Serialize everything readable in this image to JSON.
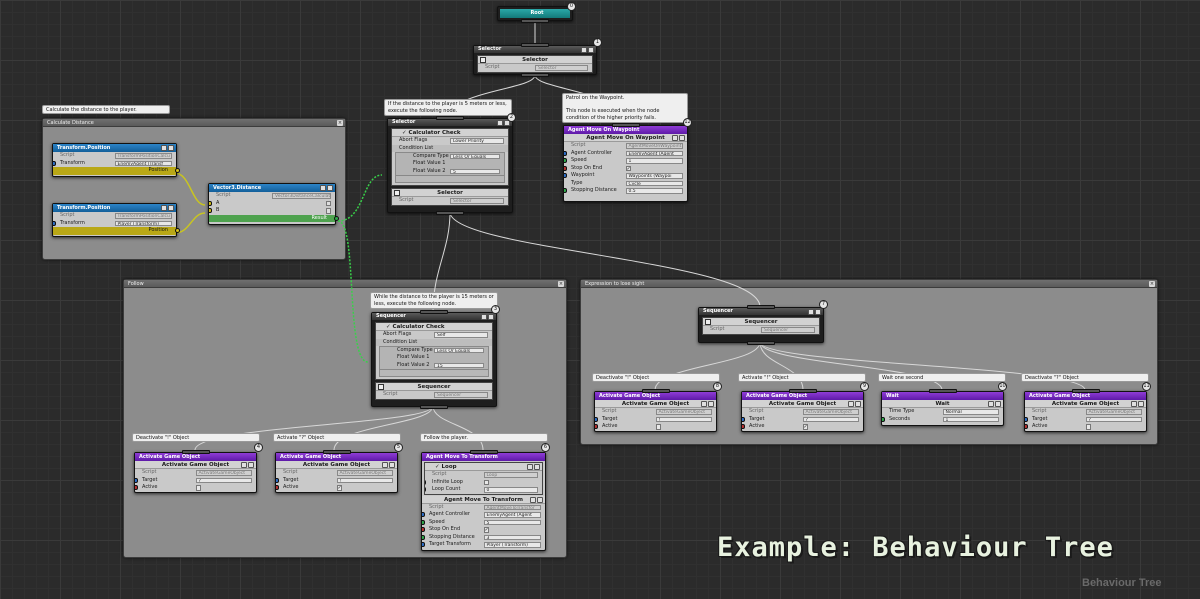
{
  "root": {
    "title": "Root",
    "num": "0"
  },
  "selector1": {
    "header": "Selector",
    "title": "Selector",
    "script_label": "Script",
    "script_value": "Selector",
    "num": "1"
  },
  "comments": {
    "calc": "Calculate the distance to the player.",
    "if5": "If the distance to the player is 5 meters or less, execute the following node.",
    "patrol": "Patrol on the Waypoint.\n\nThis node is executed when the node condition of the higher priority fails.",
    "while15": "While the distance to the player is 15 meters or less, execute the following node.",
    "deact1": "Deactivate \"!\" Object",
    "act_q": "Activate \"?\" Object",
    "follow": "Follow the player.",
    "deact2": "Deactivate \"!\" Object",
    "act_ex": "Activate \"!\" Object",
    "wait": "Wait one second",
    "deact_q": "Deactivate \"?\" Object"
  },
  "groups": {
    "calc": "Calculate Distance",
    "follow": "Follow",
    "lost": "Expression to lose sight"
  },
  "tp1": {
    "header": "Transform.Position",
    "script_label": "Script",
    "script_value": "TransformPositionCalcu",
    "transform_label": "Transform",
    "transform_value": "EnemyAgent (Transf",
    "output": "Position"
  },
  "tp2": {
    "header": "Transform.Position",
    "script_label": "Script",
    "script_value": "TransformPositionCalcu",
    "transform_label": "Transform",
    "transform_value": "Player (Transform)",
    "output": "Position"
  },
  "dist": {
    "header": "Vector3.Distance",
    "script_label": "Script",
    "script_value": "Vector3DistanceCalculat",
    "a": "A",
    "b": "B",
    "output": "Result"
  },
  "sel2": {
    "header": "Selector",
    "num": "2",
    "cond_title": "Calculator Check",
    "abort_label": "Abort Flags",
    "abort_value": "Lower Priority",
    "cond_list": "Condition List",
    "compare_label": "Compare Type",
    "compare_value": "Less Or Equals",
    "fv1_label": "Float Value 1",
    "fv1_value": "",
    "fv2_label": "Float Value 2",
    "fv2_value": "5",
    "title": "Selector",
    "script_label": "Script",
    "script_value": "Selector"
  },
  "waypoint": {
    "header": "Agent Move On Waypoint",
    "num": "12",
    "title": "Agent Move On Waypoint",
    "script_label": "Script",
    "script_value": "AgentMoveOnWaypoint",
    "controller_label": "Agent Controller",
    "controller_value": "EnemyAgent (Agent",
    "speed_label": "Speed",
    "speed_value": "1",
    "stop_label": "Stop On End",
    "wp_label": "Waypoint",
    "wp_value": "Waypoints (Waypoi",
    "type_label": "Type",
    "type_value": "Cycle",
    "sd_label": "Stopping Distance",
    "sd_value": "0.5"
  },
  "seq3": {
    "header": "Sequencer",
    "num": "3",
    "cond_title": "Calculator Check",
    "abort_label": "Abort Flags",
    "abort_value": "Self",
    "cond_list": "Condition List",
    "compare_label": "Compare Type",
    "compare_value": "Less Or Equals",
    "fv1_label": "Float Value 1",
    "fv1_value": "",
    "fv2_label": "Float Value 2",
    "fv2_value": "15",
    "title": "Sequencer",
    "script_label": "Script",
    "script_value": "Sequencer"
  },
  "ago4": {
    "header": "Activate Game Object",
    "num": "4",
    "title": "Activate Game Object",
    "script_label": "Script",
    "script_value": "ActivateGameObject",
    "target_label": "Target",
    "target_value": "?",
    "active_label": "Active",
    "active_checked": ""
  },
  "ago5": {
    "header": "Activate Game Object",
    "num": "5",
    "title": "Activate Game Object",
    "script_label": "Script",
    "script_value": "ActivateGameObject",
    "target_label": "Target",
    "target_value": "!",
    "active_label": "Active",
    "active_checked": "✓"
  },
  "loop6": {
    "header": "Agent Move To Transform",
    "num": "6",
    "dec_title": "Loop",
    "dec_script_label": "Script",
    "dec_script_value": "Loop",
    "inf_label": "Infinite Loop",
    "count_label": "Loop Count",
    "count_value": "0",
    "title": "Agent Move To Transform",
    "script_label": "Script",
    "script_value": "AgentMoveToTransfor",
    "controller_label": "Agent Controller",
    "controller_value": "EnemyAgent (Agent",
    "speed_label": "Speed",
    "speed_value": "5",
    "stop_label": "Stop On End",
    "sd_label": "Stopping Distance",
    "sd_value": "3",
    "tt_label": "Target Transform",
    "tt_value": "Player (Transform)"
  },
  "seq7": {
    "header": "Sequencer",
    "num": "7",
    "title": "Sequencer",
    "script_label": "Script",
    "script_value": "Sequencer"
  },
  "ago8": {
    "header": "Activate Game Object",
    "num": "8",
    "title": "Activate Game Object",
    "script_label": "Script",
    "script_value": "ActivateGameObject",
    "target_label": "Target",
    "target_value": "!",
    "active_label": "Active",
    "active_checked": ""
  },
  "ago9": {
    "header": "Activate Game Object",
    "num": "9",
    "title": "Activate Game Object",
    "script_label": "Script",
    "script_value": "ActivateGameObject",
    "target_label": "Target",
    "target_value": "?",
    "active_label": "Active",
    "active_checked": "✓"
  },
  "wait10": {
    "header": "Wait",
    "num": "10",
    "title": "Wait",
    "tt_label": "Time Type",
    "tt_value": "Normal",
    "sec_label": "Seconds",
    "sec_value": "1"
  },
  "ago11": {
    "header": "Activate Game Object",
    "num": "11",
    "title": "Activate Game Object",
    "script_label": "Script",
    "script_value": "ActivateGameObject",
    "target_label": "Target",
    "target_value": "?",
    "active_label": "Active",
    "active_checked": ""
  },
  "overlay": {
    "title": "Example: Behaviour Tree",
    "watermark": "Behaviour Tree"
  }
}
